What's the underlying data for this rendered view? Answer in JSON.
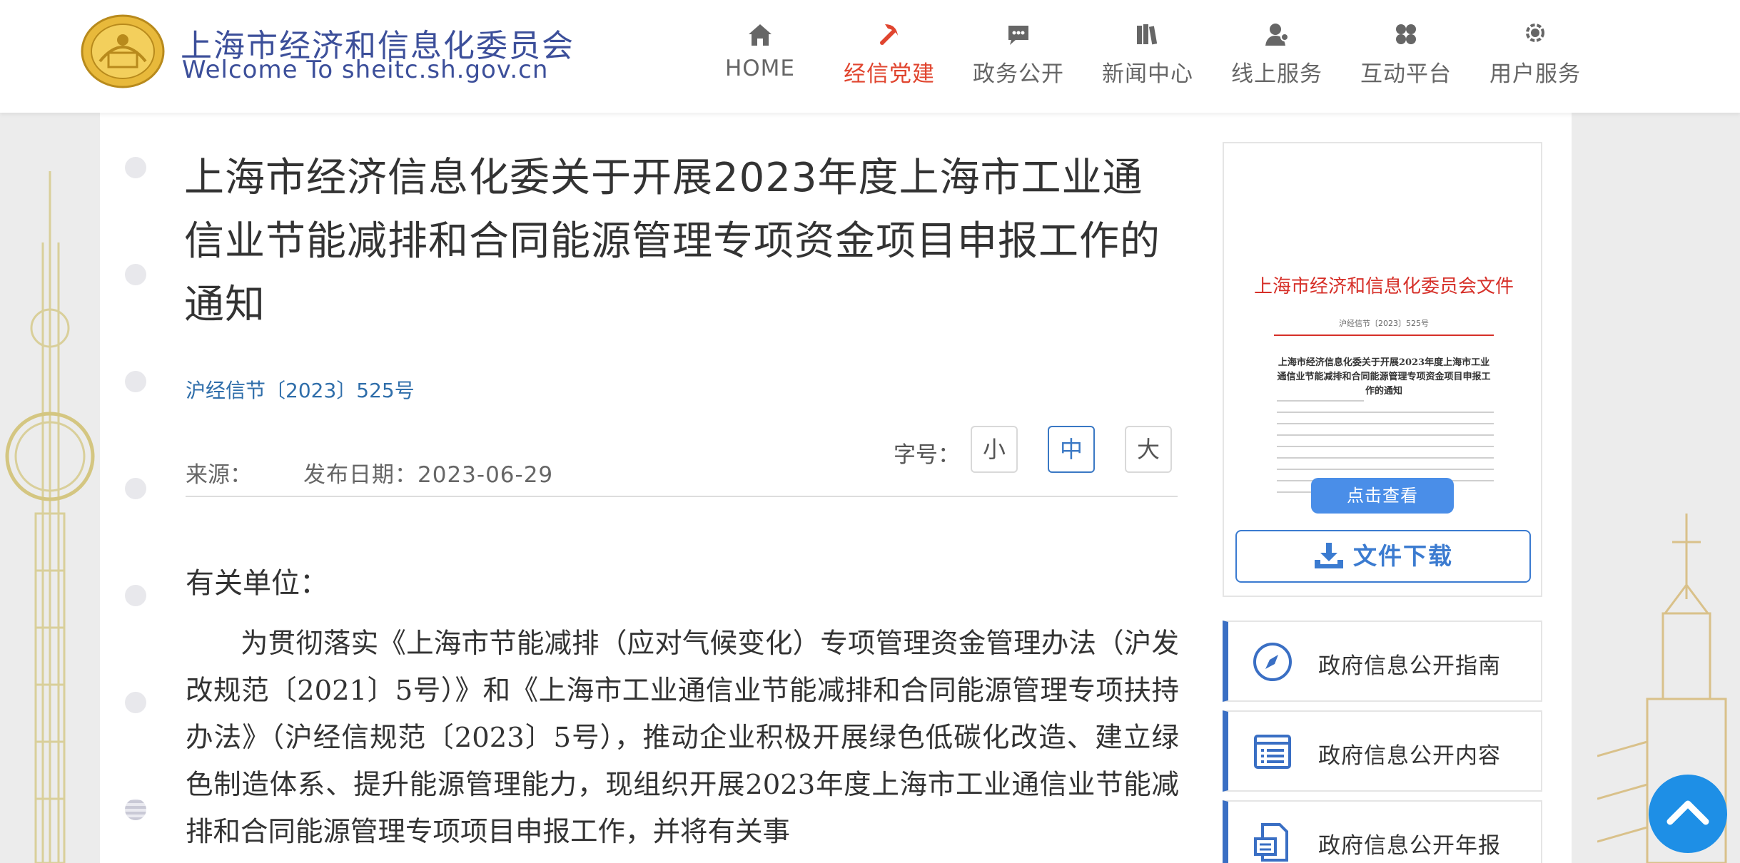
{
  "header": {
    "site_title": "上海市经济和信息化委员会",
    "site_subtitle": "Welcome To sheitc.sh.gov.cn",
    "nav": [
      {
        "label": "HOME",
        "icon": "home-icon",
        "active": false
      },
      {
        "label": "经信党建",
        "icon": "party-emblem-icon",
        "active": true
      },
      {
        "label": "政务公开",
        "icon": "chat-bubble-icon",
        "active": false
      },
      {
        "label": "新闻中心",
        "icon": "books-icon",
        "active": false
      },
      {
        "label": "线上服务",
        "icon": "user-service-icon",
        "active": false
      },
      {
        "label": "互动平台",
        "icon": "clover-icon",
        "active": false
      },
      {
        "label": "用户服务",
        "icon": "user-settings-icon",
        "active": false
      }
    ]
  },
  "article": {
    "title": "上海市经济信息化委关于开展2023年度上海市工业通信业节能减排和合同能源管理专项资金项目申报工作的通知",
    "doc_number": "沪经信节〔2023〕525号",
    "source_label": "来源：",
    "date_text": "发布日期：2023-06-29",
    "font_size_label": "字号：",
    "font_sizes": [
      "小",
      "中",
      "大"
    ],
    "font_size_selected": "中",
    "salutation": "有关单位：",
    "body": "为贯彻落实《上海市节能减排（应对气候变化）专项管理资金管理办法（沪发改规范〔2021〕5号）》和《上海市工业通信业节能减排和合同能源管理专项扶持办法》（沪经信规范〔2023〕5号），推动企业积极开展绿色低碳化改造、建立绿色制造体系、提升能源管理能力，现组织开展2023年度上海市工业通信业节能减排和合同能源管理专项项目申报工作，并将有关事"
  },
  "sidebar": {
    "doc_preview": {
      "header": "上海市经济和信息化委员会文件",
      "doc_number": "沪经信节〔2023〕525号",
      "subtitle": "上海市经济信息化委关于开展2023年度上海市工业通信业节能减排和合同能源管理专项资金项目申报工作的通知"
    },
    "view_button": "点击查看",
    "download_button": "文件下载",
    "links": [
      {
        "label": "政府信息公开指南",
        "icon": "compass-icon"
      },
      {
        "label": "政府信息公开内容",
        "icon": "list-document-icon"
      },
      {
        "label": "政府信息公开年报",
        "icon": "report-document-icon"
      }
    ]
  },
  "colors": {
    "brand_blue": "#3c4f9a",
    "active_red": "#e0452f",
    "link_blue": "#2f6eaa",
    "accent_blue": "#3b7bd0"
  }
}
